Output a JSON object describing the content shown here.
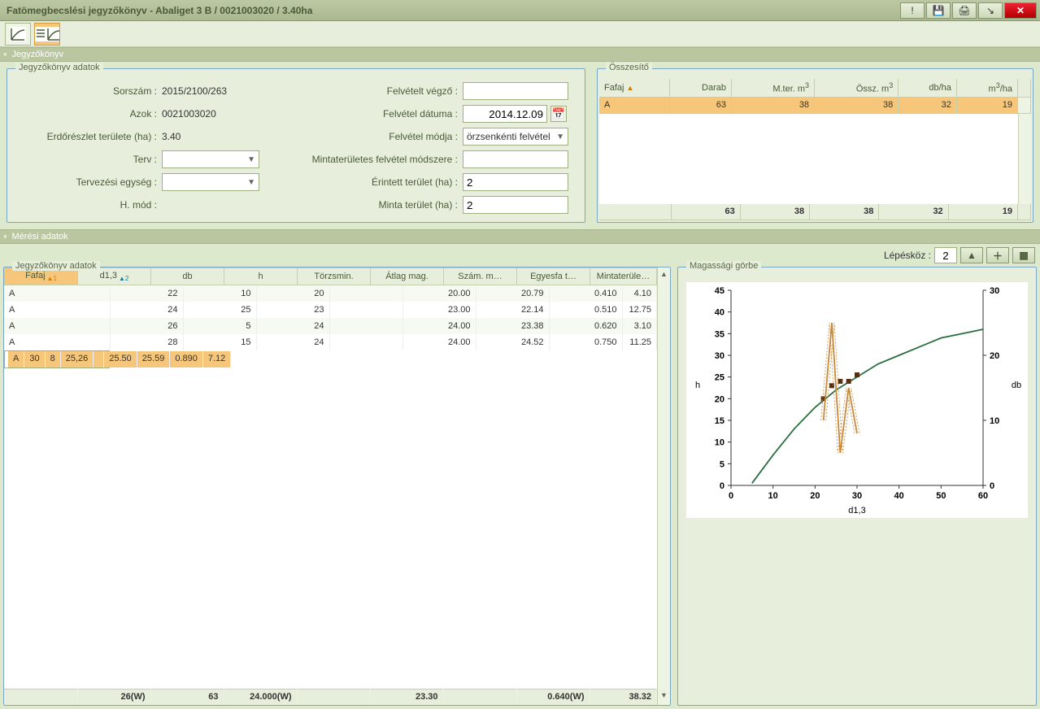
{
  "window": {
    "title": "Fatömegbecslési jegyzőkönyv - Abaliget 3 B / 0021003020 / 3.40ha"
  },
  "sections": {
    "journal": "Jegyzőkönyv",
    "journal_data": "Jegyzőkönyv adatok",
    "summary": "Összesítő",
    "meas": "Mérési adatok",
    "height_curve": "Magassági görbe"
  },
  "form": {
    "sorszam_lbl": "Sorszám :",
    "sorszam": "2015/2100/263",
    "azok_lbl": "Azok :",
    "azok": "0021003020",
    "area_lbl": "Erdőrészlet területe (ha) :",
    "area": "3.40",
    "terv_lbl": "Terv :",
    "terv": "",
    "unit_lbl": "Tervezési egység :",
    "unit": "",
    "hmod_lbl": "H. mód :",
    "recorder_lbl": "Felvételt végző :",
    "recorder": "",
    "date_lbl": "Felvétel dátuma :",
    "date": "2014.12.09",
    "method_lbl": "Felvétel módja :",
    "method": "örzsenkénti felvétel",
    "sample_method_lbl": "Mintaterületes felvétel módszere :",
    "sample_method": "",
    "affected_lbl": "Érintett terület (ha) :",
    "affected": "2",
    "sample_area_lbl": "Minta terület (ha) :",
    "sample_area": "2"
  },
  "summary": {
    "headers": [
      "Fafaj",
      "Darab",
      "M.ter. m",
      "Össz. m",
      "db/ha",
      "m /ha"
    ],
    "row": {
      "fafaj": "A",
      "darab": "63",
      "mter": "38",
      "ossz": "38",
      "dbha": "32",
      "m3ha": "19"
    },
    "totals": {
      "darab": "63",
      "mter": "38",
      "ossz": "38",
      "dbha": "32",
      "m3ha": "19"
    }
  },
  "step": {
    "label": "Lépésköz :",
    "value": "2"
  },
  "meas": {
    "headers": [
      "Fafaj",
      "d1,3",
      "db",
      "h",
      "Törzsmin.",
      "Átlag mag.",
      "Szám. m…",
      "Egyesfa t…",
      "Mintaterüle…"
    ],
    "rows": [
      {
        "f": "A",
        "d": "22",
        "db": "10",
        "h": "20",
        "tm": "",
        "avg": "20.00",
        "sz": "20.79",
        "eg": "0.410",
        "mt": "4.10"
      },
      {
        "f": "A",
        "d": "24",
        "db": "25",
        "h": "23",
        "tm": "",
        "avg": "23.00",
        "sz": "22.14",
        "eg": "0.510",
        "mt": "12.75"
      },
      {
        "f": "A",
        "d": "26",
        "db": "5",
        "h": "24",
        "tm": "",
        "avg": "24.00",
        "sz": "23.38",
        "eg": "0.620",
        "mt": "3.10"
      },
      {
        "f": "A",
        "d": "28",
        "db": "15",
        "h": "24",
        "tm": "",
        "avg": "24.00",
        "sz": "24.52",
        "eg": "0.750",
        "mt": "11.25"
      },
      {
        "f": "A",
        "d": "30",
        "db": "8",
        "h": "25,26",
        "tm": "",
        "avg": "25.50",
        "sz": "25.59",
        "eg": "0.890",
        "mt": "7.12"
      }
    ],
    "footer": {
      "d": "26(W)",
      "db": "63",
      "h": "24.000(W)",
      "avg": "23.30",
      "eg": "0.640(W)",
      "mt": "38.32"
    }
  },
  "chart_data": {
    "type": "line",
    "title": "",
    "xlabel": "d1,3",
    "y1label": "h",
    "y2label": "db",
    "xlim": [
      0,
      60
    ],
    "y1lim": [
      0,
      45
    ],
    "y2lim": [
      0,
      30
    ],
    "x_ticks": [
      0,
      10,
      20,
      30,
      40,
      50,
      60
    ],
    "y1_ticks": [
      0,
      5,
      10,
      15,
      20,
      25,
      30,
      35,
      40,
      45
    ],
    "y2_ticks": [
      0,
      10,
      20,
      30
    ],
    "series": [
      {
        "name": "height_curve",
        "axis": "y1",
        "type": "line",
        "color": "#2a6e3f",
        "x": [
          5,
          10,
          15,
          20,
          25,
          30,
          35,
          40,
          45,
          50,
          55,
          60
        ],
        "y": [
          0.5,
          7,
          13,
          18,
          22,
          25,
          28,
          30,
          32,
          34,
          35,
          36
        ]
      },
      {
        "name": "measured_h",
        "axis": "y1",
        "type": "scatter",
        "color": "#5a2e0f",
        "x": [
          22,
          24,
          26,
          28,
          30
        ],
        "y": [
          20,
          23,
          24,
          24,
          25.5
        ]
      },
      {
        "name": "db_distribution",
        "axis": "y2",
        "type": "line",
        "color": "#c9893b",
        "x": [
          22,
          24,
          26,
          28,
          30
        ],
        "y": [
          10,
          25,
          5,
          15,
          8
        ]
      }
    ]
  }
}
